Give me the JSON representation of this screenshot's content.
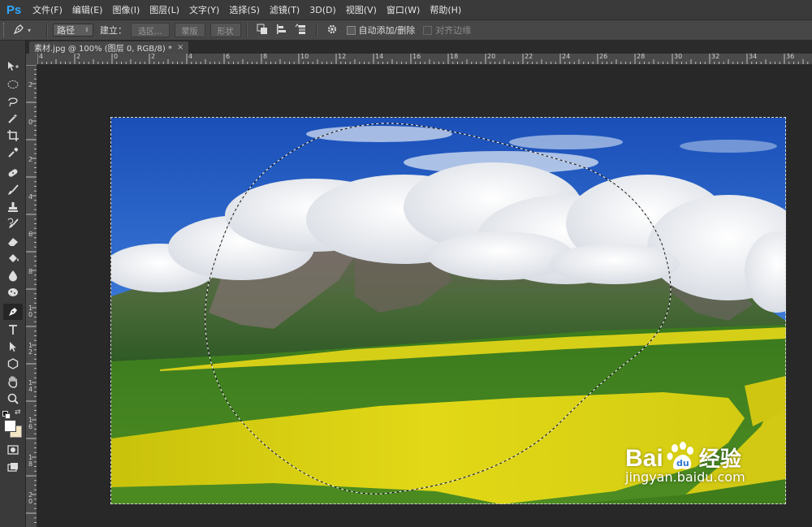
{
  "app": {
    "logo": "Ps"
  },
  "menu": [
    "文件(F)",
    "编辑(E)",
    "图像(I)",
    "图层(L)",
    "文字(Y)",
    "选择(S)",
    "滤镜(T)",
    "3D(D)",
    "视图(V)",
    "窗口(W)",
    "帮助(H)"
  ],
  "options": {
    "mode_value": "路径",
    "make_label": "建立：",
    "selection_button": "选区...",
    "mask_button": "蒙版",
    "shape_button": "形状",
    "auto_add_delete": "自动添加/删除",
    "align_edges": "对齐边缘"
  },
  "document": {
    "tab_title": "素材.jpg @ 100% (图层 0, RGB/8) *",
    "close": "×"
  },
  "rulers": {
    "horizontal": [
      "4",
      "2",
      "0",
      "2",
      "4",
      "6",
      "8",
      "10",
      "12",
      "14",
      "16",
      "18",
      "20",
      "22",
      "24",
      "26",
      "28",
      "30",
      "32",
      "34",
      "36"
    ],
    "vertical": [
      "2",
      "0",
      "2",
      "4",
      "6",
      "8",
      "10",
      "12",
      "14",
      "16",
      "18",
      "20"
    ]
  },
  "toolbar": {
    "tools": [
      "move-tool",
      "marquee-tool",
      "lasso-tool",
      "magic-wand-tool",
      "crop-tool",
      "eyedropper-tool",
      "healing-brush-tool",
      "brush-tool",
      "clone-stamp-tool",
      "history-brush-tool",
      "eraser-tool",
      "paint-bucket-tool",
      "blur-tool",
      "dodge-tool",
      "pen-tool",
      "type-tool",
      "path-selection-tool",
      "shape-tool",
      "hand-tool",
      "zoom-tool"
    ],
    "active_tool": "pen-tool",
    "foreground_color": "#ffffff",
    "background_color": "#f3e6c4"
  },
  "watermark": {
    "brand_left": "Bai",
    "brand_right": "经验",
    "url": "jingyan.baidu.com"
  },
  "colors": {
    "menubar": "#3a3a3a",
    "optionsbar": "#474747",
    "workspace": "#282828",
    "accent": "#31a8ff"
  }
}
